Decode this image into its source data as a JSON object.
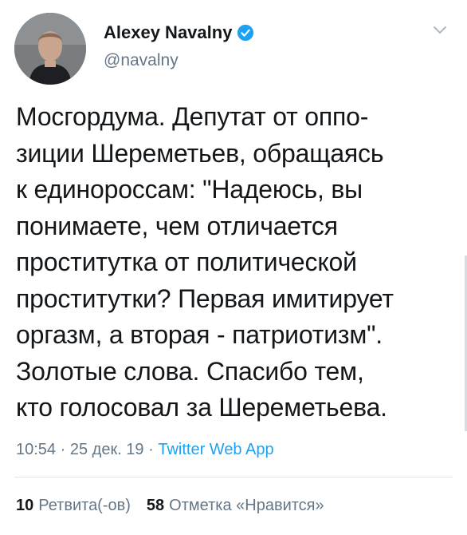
{
  "author": {
    "display_name": "Alexey Navalny",
    "handle": "@navalny",
    "verified": true,
    "avatar_icon": "profile-photo"
  },
  "tweet": {
    "text": "Мосгордума. Депутат от оппо-\nзиции Шереметьев, обращаясь\nк единороссам: \"Надеюсь, вы\nпонимаете, чем отличается\nпроститутка от политической\nпроститутки? Первая имитирует\nоргазм, а вторая - патриотизм\".\nЗолотые слова. Спасибо тем,\nкто голосовал за Шереметьева."
  },
  "meta": {
    "time": "10:54",
    "separator1": " · ",
    "date": "25 дек. 19",
    "separator2": " · ",
    "source": "Twitter Web App"
  },
  "stats": {
    "retweets_count": "10",
    "retweets_label": "Ретвита(-ов)",
    "likes_count": "58",
    "likes_label": "Отметка «Нравится»"
  },
  "colors": {
    "accent": "#1da1f2",
    "text": "#14171a",
    "muted": "#657786"
  }
}
